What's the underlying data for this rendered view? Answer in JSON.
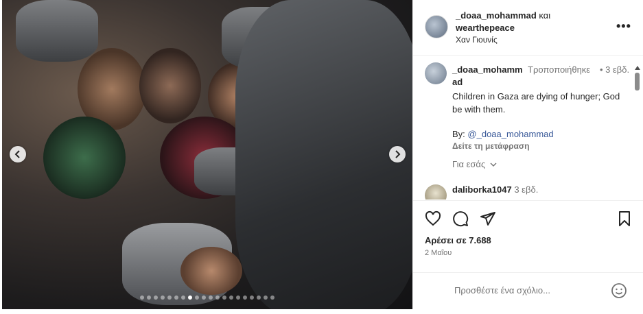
{
  "header": {
    "username": "_doaa_mohammad",
    "connector": "και",
    "collab": "wearthepeace",
    "location": "Χαν Γιουνίς",
    "more_icon": "more-horizontal-icon"
  },
  "caption": {
    "username": "_doaa_mohammad",
    "edited": "Τροποποιήθηκε",
    "time": "• 3 εβδ.",
    "text": "Children in Gaza are dying of hunger; God be with them.",
    "by_label": "By:",
    "by_mention": "@_doaa_mohammad",
    "translate": "Δείτε τη μετάφραση",
    "see_more": "Για εσάς"
  },
  "comment2": {
    "username": "daliborka1047",
    "time": "3 εβδ."
  },
  "actions": {
    "likes": "Αρέσει σε 7.688",
    "date": "2 Μαΐου"
  },
  "add_comment": {
    "placeholder": "Προσθέστε ένα σχόλιο..."
  },
  "carousel": {
    "total": 20,
    "active": 7
  }
}
